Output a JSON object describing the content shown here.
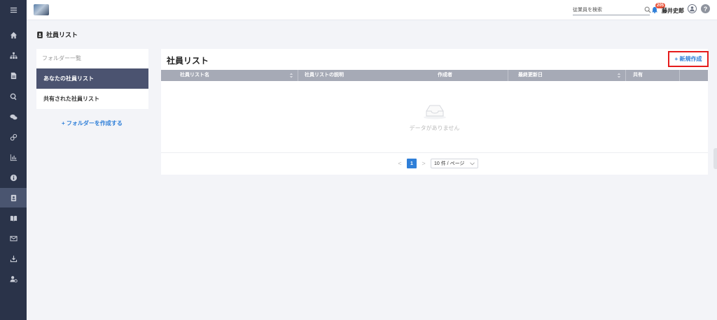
{
  "rail": {
    "items": [
      {
        "name": "menu-icon",
        "active": false
      },
      {
        "name": "home-icon",
        "active": false
      },
      {
        "name": "org-chart-icon",
        "active": false
      },
      {
        "name": "document-icon",
        "active": false
      },
      {
        "name": "search-icon",
        "active": false
      },
      {
        "name": "chat-icon",
        "active": false
      },
      {
        "name": "link-icon",
        "active": false
      },
      {
        "name": "chart-icon",
        "active": false
      },
      {
        "name": "info-icon",
        "active": false
      },
      {
        "name": "employee-list-icon",
        "active": true
      },
      {
        "name": "book-icon",
        "active": false
      },
      {
        "name": "mail-icon",
        "active": false
      },
      {
        "name": "download-icon",
        "active": false
      },
      {
        "name": "user-settings-icon",
        "active": false
      }
    ]
  },
  "header": {
    "search_placeholder": "従業員を検索",
    "notification_count": "205",
    "username": "藤井史郎",
    "help_label": "?"
  },
  "page": {
    "title": "社員リスト"
  },
  "folders": {
    "heading": "フォルダー一覧",
    "items": [
      {
        "label": "あなたの社員リスト",
        "active": true
      },
      {
        "label": "共有された社員リスト",
        "active": false
      }
    ],
    "create_label": "+ フォルダーを作成する"
  },
  "main": {
    "title": "社員リスト",
    "new_button": "+ 新規作成",
    "columns": [
      "社員リスト名",
      "社員リストの説明",
      "作成者",
      "最終更新日",
      "共有"
    ],
    "empty_text": "データがありません"
  },
  "pagination": {
    "prev": "<",
    "current_page": "1",
    "next": ">",
    "page_size": "10 件 / ページ"
  },
  "colors": {
    "rail_bg": "#2a3349",
    "accent": "#2f7fd8",
    "highlight_border": "#e51c1c",
    "table_header": "#a6aab6"
  }
}
